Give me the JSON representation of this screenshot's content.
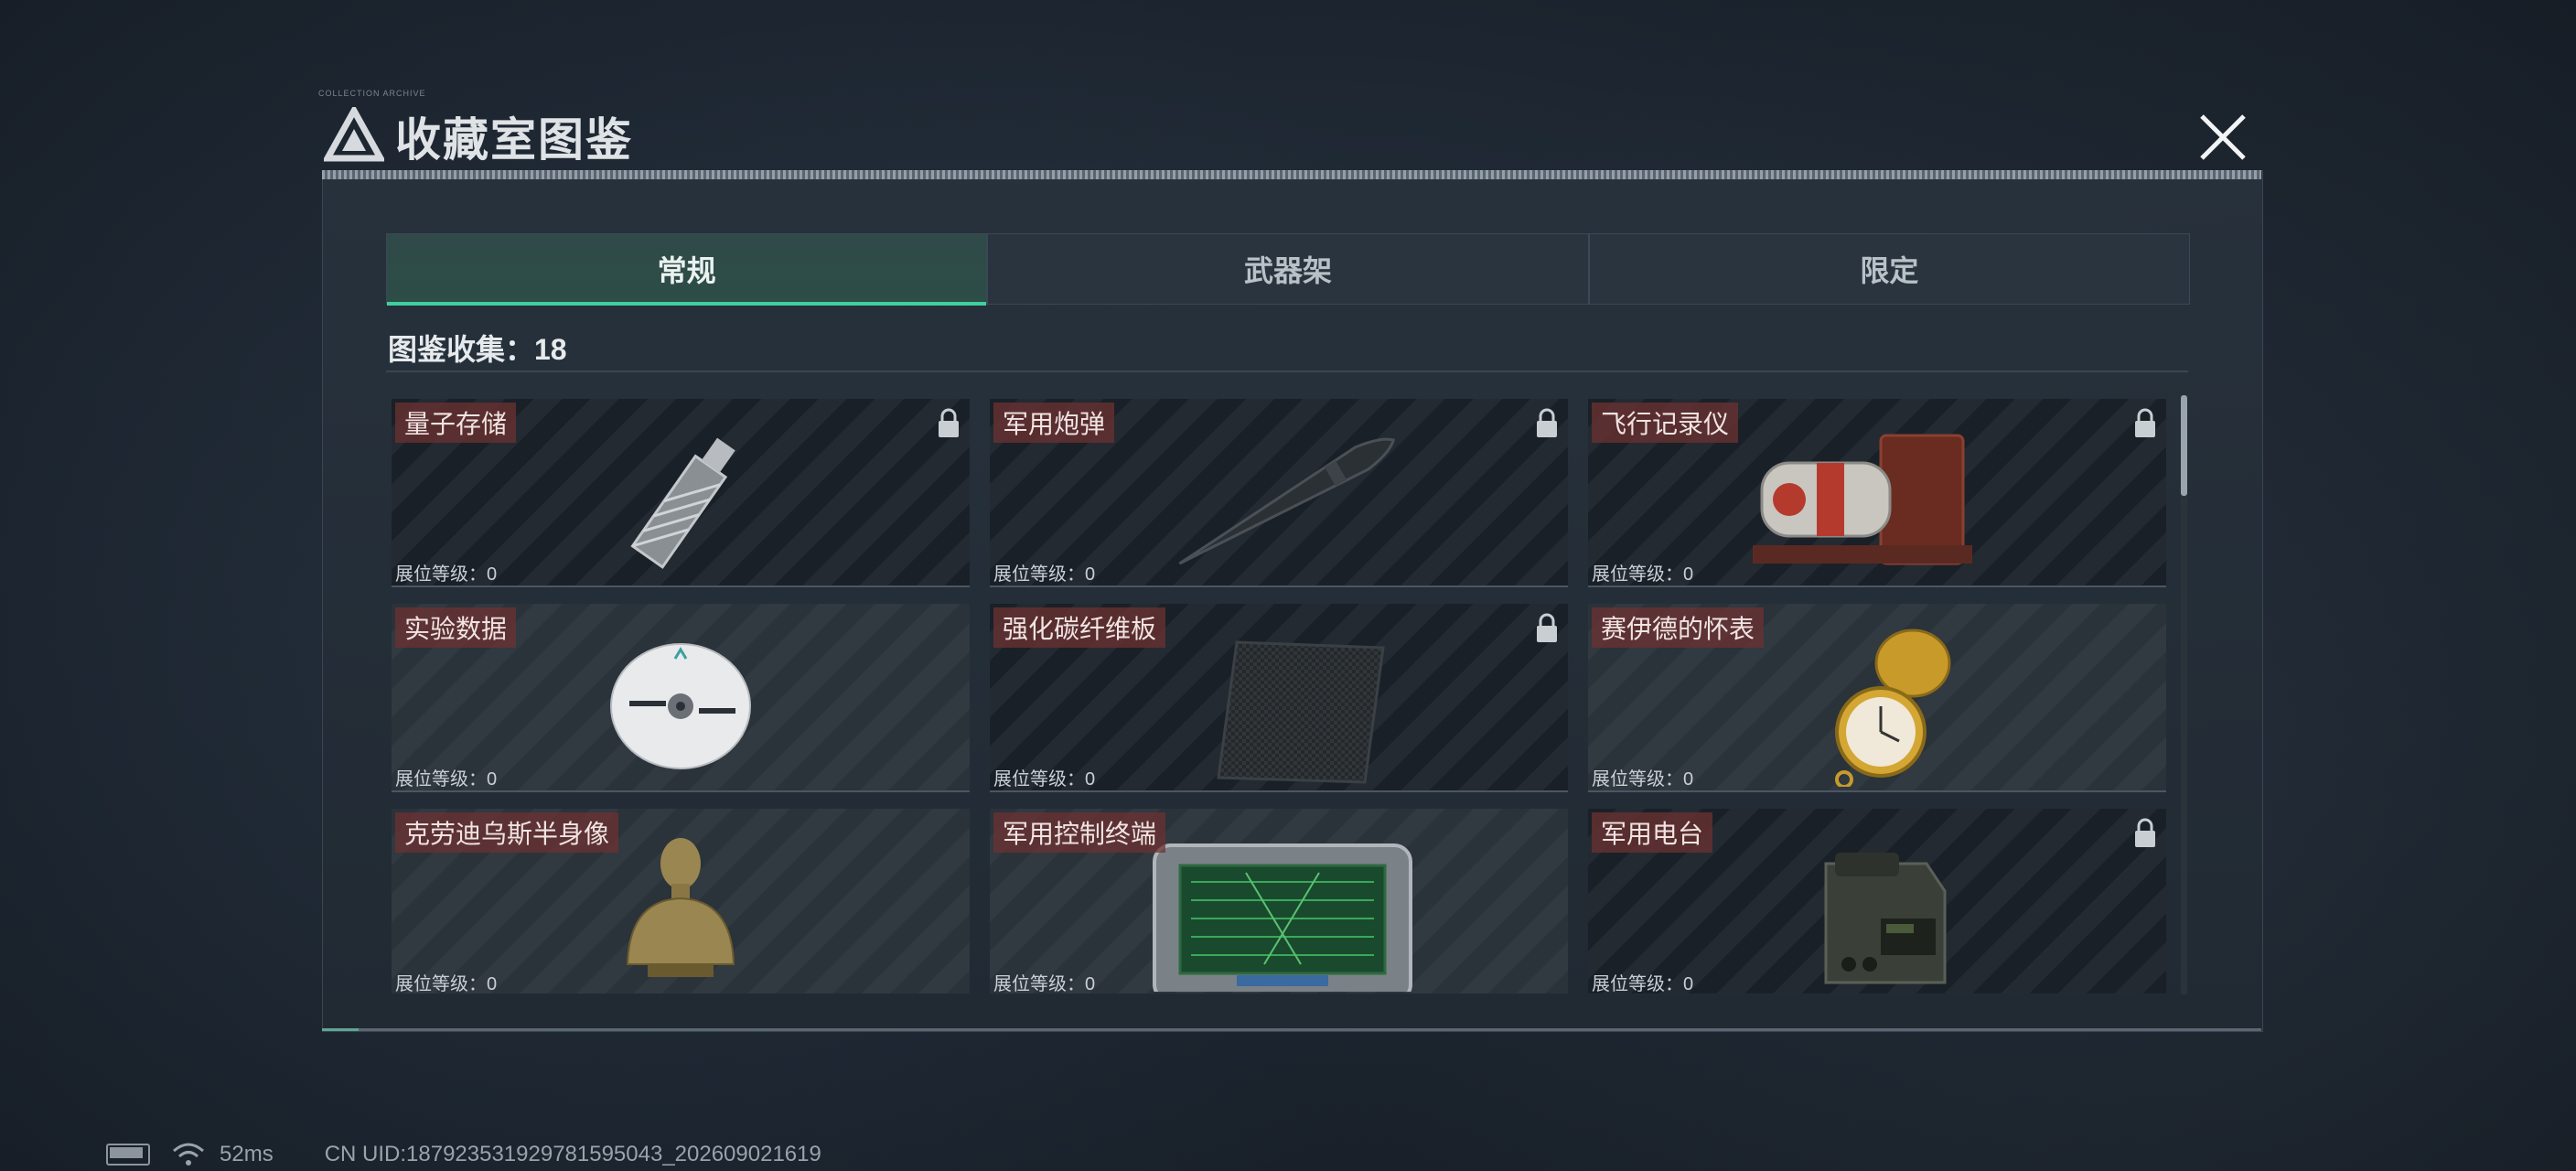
{
  "window": {
    "title": "收藏室图鉴",
    "tiny_caption": "COLLECTION ARCHIVE"
  },
  "tabs": [
    {
      "label": "常规",
      "active": true
    },
    {
      "label": "武器架",
      "active": false
    },
    {
      "label": "限定",
      "active": false
    }
  ],
  "collection": {
    "label": "图鉴收集：18"
  },
  "items": [
    {
      "name": "量子存储",
      "level": "展位等级：0",
      "locked": true,
      "icon": "usb-drive-icon"
    },
    {
      "name": "军用炮弹",
      "level": "展位等级：0",
      "locked": true,
      "icon": "artillery-shell-icon"
    },
    {
      "name": "飞行记录仪",
      "level": "展位等级：0",
      "locked": true,
      "icon": "flight-recorder-icon"
    },
    {
      "name": "实验数据",
      "level": "展位等级：0",
      "locked": false,
      "icon": "cd-disc-icon"
    },
    {
      "name": "强化碳纤维板",
      "level": "展位等级：0",
      "locked": true,
      "icon": "carbon-plate-icon"
    },
    {
      "name": "赛伊德的怀表",
      "level": "展位等级：0",
      "locked": false,
      "icon": "pocket-watch-icon"
    },
    {
      "name": "克劳迪乌斯半身像",
      "level": "展位等级：0",
      "locked": false,
      "icon": "bust-statue-icon"
    },
    {
      "name": "军用控制终端",
      "level": "展位等级：0",
      "locked": false,
      "icon": "control-terminal-icon"
    },
    {
      "name": "军用电台",
      "level": "展位等级：0",
      "locked": true,
      "icon": "military-radio-icon"
    }
  ],
  "status_bar": {
    "ping": "52ms",
    "uid": "CN UID:187923531929781595043_202609021619"
  },
  "colors": {
    "accent": "#3fd0a0",
    "name_tag": "#6e3232"
  }
}
